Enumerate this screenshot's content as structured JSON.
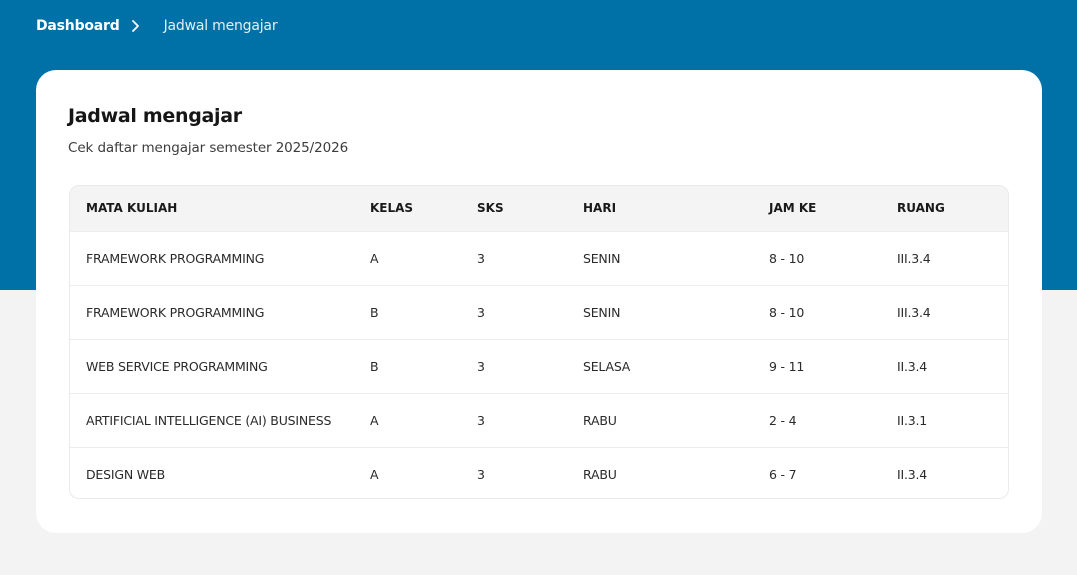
{
  "breadcrumb": {
    "home_label": "Dashboard",
    "current_label": "Jadwal mengajar"
  },
  "card": {
    "title": "Jadwal mengajar",
    "subtitle": "Cek daftar mengajar semester 2025/2026"
  },
  "table": {
    "headers": [
      "MATA KULIAH",
      "KELAS",
      "SKS",
      "HARI",
      "JAM KE",
      "RUANG"
    ],
    "rows": [
      [
        "FRAMEWORK PROGRAMMING",
        "A",
        "3",
        "SENIN",
        "8 - 10",
        "III.3.4"
      ],
      [
        "FRAMEWORK PROGRAMMING",
        "B",
        "3",
        "SENIN",
        "8 - 10",
        "III.3.4"
      ],
      [
        "WEB SERVICE PROGRAMMING",
        "B",
        "3",
        "SELASA",
        "9 - 11",
        "II.3.4"
      ],
      [
        "ARTIFICIAL INTELLIGENCE (AI) BUSINESS",
        "A",
        "3",
        "RABU",
        "2 - 4",
        "II.3.1"
      ],
      [
        "DESIGN WEB",
        "A",
        "3",
        "RABU",
        "6 - 7",
        "II.3.4"
      ]
    ]
  },
  "icons": {
    "breadcrumb_separator": "chevron-right-icon"
  },
  "colors": {
    "header_band": "#0071a7",
    "page_background": "#f3f3f3",
    "card_background": "#ffffff"
  }
}
